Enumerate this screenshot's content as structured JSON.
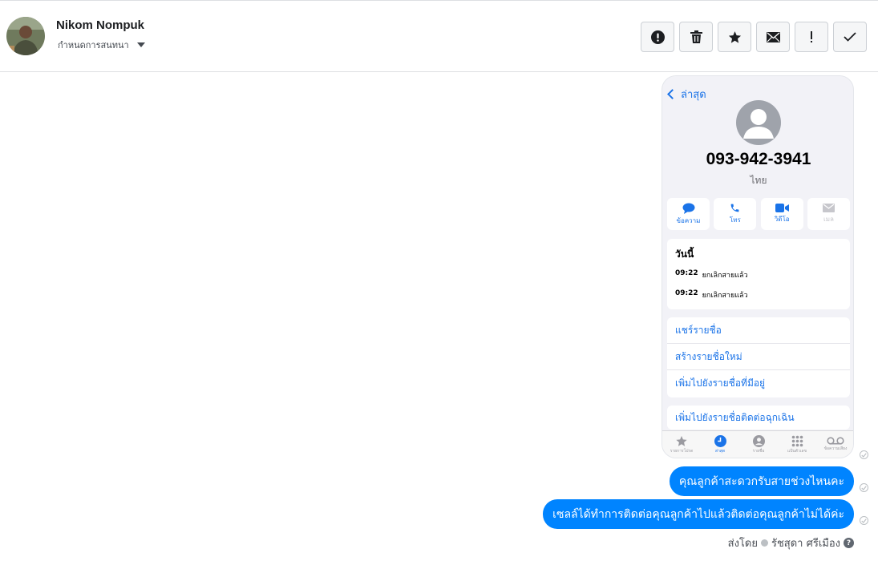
{
  "header": {
    "contact_name": "Nikom Nompuk",
    "conversation_settings_label": "กำหนดการสนทนา"
  },
  "actions": [
    {
      "name": "report-spam-button",
      "icon": "alert-circle-icon"
    },
    {
      "name": "delete-button",
      "icon": "trash-icon"
    },
    {
      "name": "star-button",
      "icon": "star-icon"
    },
    {
      "name": "mark-unread-button",
      "icon": "envelope-icon"
    },
    {
      "name": "follow-up-button",
      "icon": "exclamation-icon"
    },
    {
      "name": "mark-done-button",
      "icon": "check-icon"
    }
  ],
  "image_message": {
    "back_label": "ล่าสุด",
    "phone_number": "093-942-3941",
    "region": "ไทย",
    "contact_actions": [
      "ข้อความ",
      "โทร",
      "วิดีโอ",
      "เมล"
    ],
    "calls_title": "วันนี้",
    "calls": [
      {
        "time": "09:22",
        "status": "ยกเลิกสายแล้ว"
      },
      {
        "time": "09:22",
        "status": "ยกเลิกสายแล้ว"
      }
    ],
    "links": [
      "แชร์รายชื่อ",
      "สร้างรายชื่อใหม่",
      "เพิ่มไปยังรายชื่อที่มีอยู่"
    ],
    "emergency_link": "เพิ่มไปยังรายชื่อติดต่อฉุกเฉิน",
    "tabs": [
      "รายการโปรด",
      "ล่าสุด",
      "รายชื่อ",
      "แป้นตัวเลข",
      "ข้อความเสียง"
    ]
  },
  "messages": [
    "คุณลูกค้าสะดวกรับสายช่วงไหนคะ",
    "เซลล์ได้ทำการติดต่อคุณลูกค้าไปแล้วติดต่อคุณลูกค้าไม่ได้ค่ะ"
  ],
  "sent_by": {
    "label": "ส่งโดย",
    "agent_name": "รัชสุดา ศรีเมือง"
  },
  "colors": {
    "bubble": "#0084ff",
    "ios_link": "#1a73e8"
  }
}
